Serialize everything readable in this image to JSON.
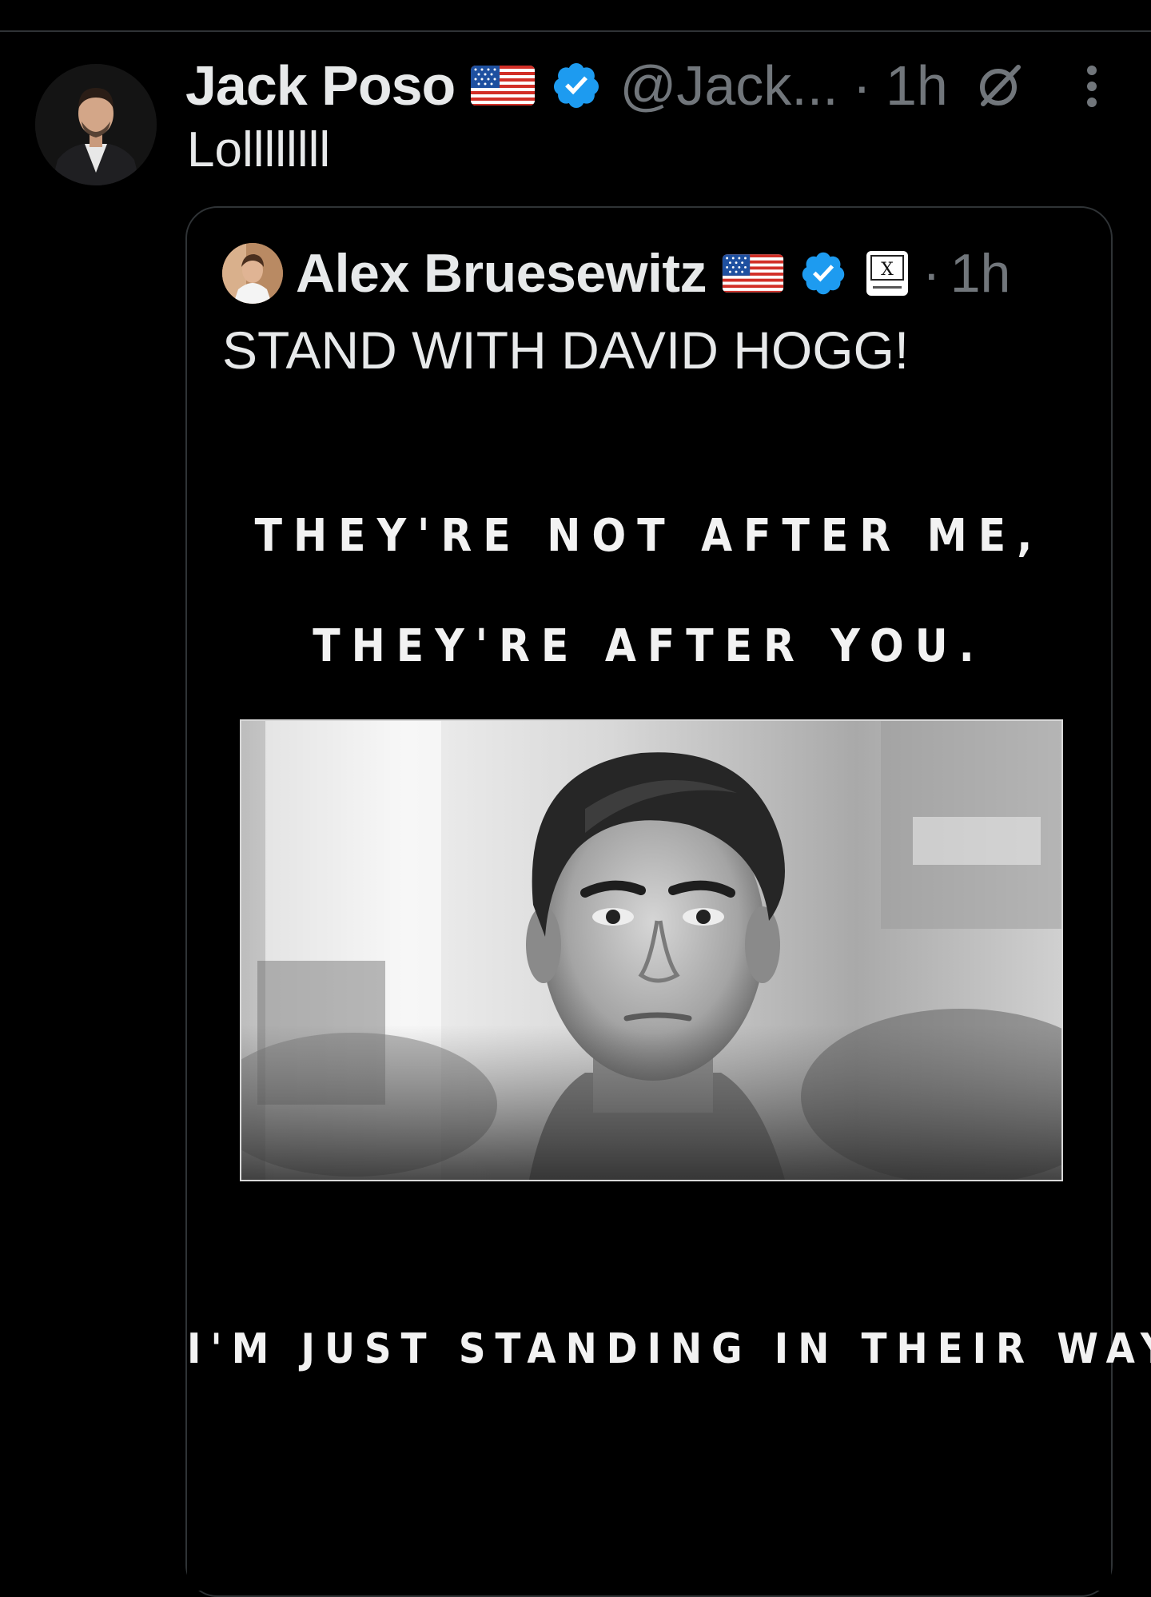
{
  "tweet": {
    "display_name": "Jack Poso",
    "flag_icon": "us-flag-icon",
    "handle": "@Jack...",
    "separator": "·",
    "time": "1h",
    "text": "Lollllllll"
  },
  "quote": {
    "display_name": "Alex Bruesewitz",
    "flag_icon": "us-flag-icon",
    "affiliation_badge_text": "X",
    "separator": "·",
    "time": "1h",
    "text": "STAND WITH DAVID HOGG!",
    "media": {
      "caption_line_1": "THEY'RE NOT AFTER ME,",
      "caption_line_2": "THEY'RE AFTER YOU.",
      "caption_line_3": "I'M JUST STANDING IN THEIR WAY."
    }
  },
  "colors": {
    "background": "#000000",
    "text_primary": "#e7e9ea",
    "text_secondary": "#71767b",
    "verified_blue": "#1d9bf0",
    "border": "#2f3336"
  }
}
